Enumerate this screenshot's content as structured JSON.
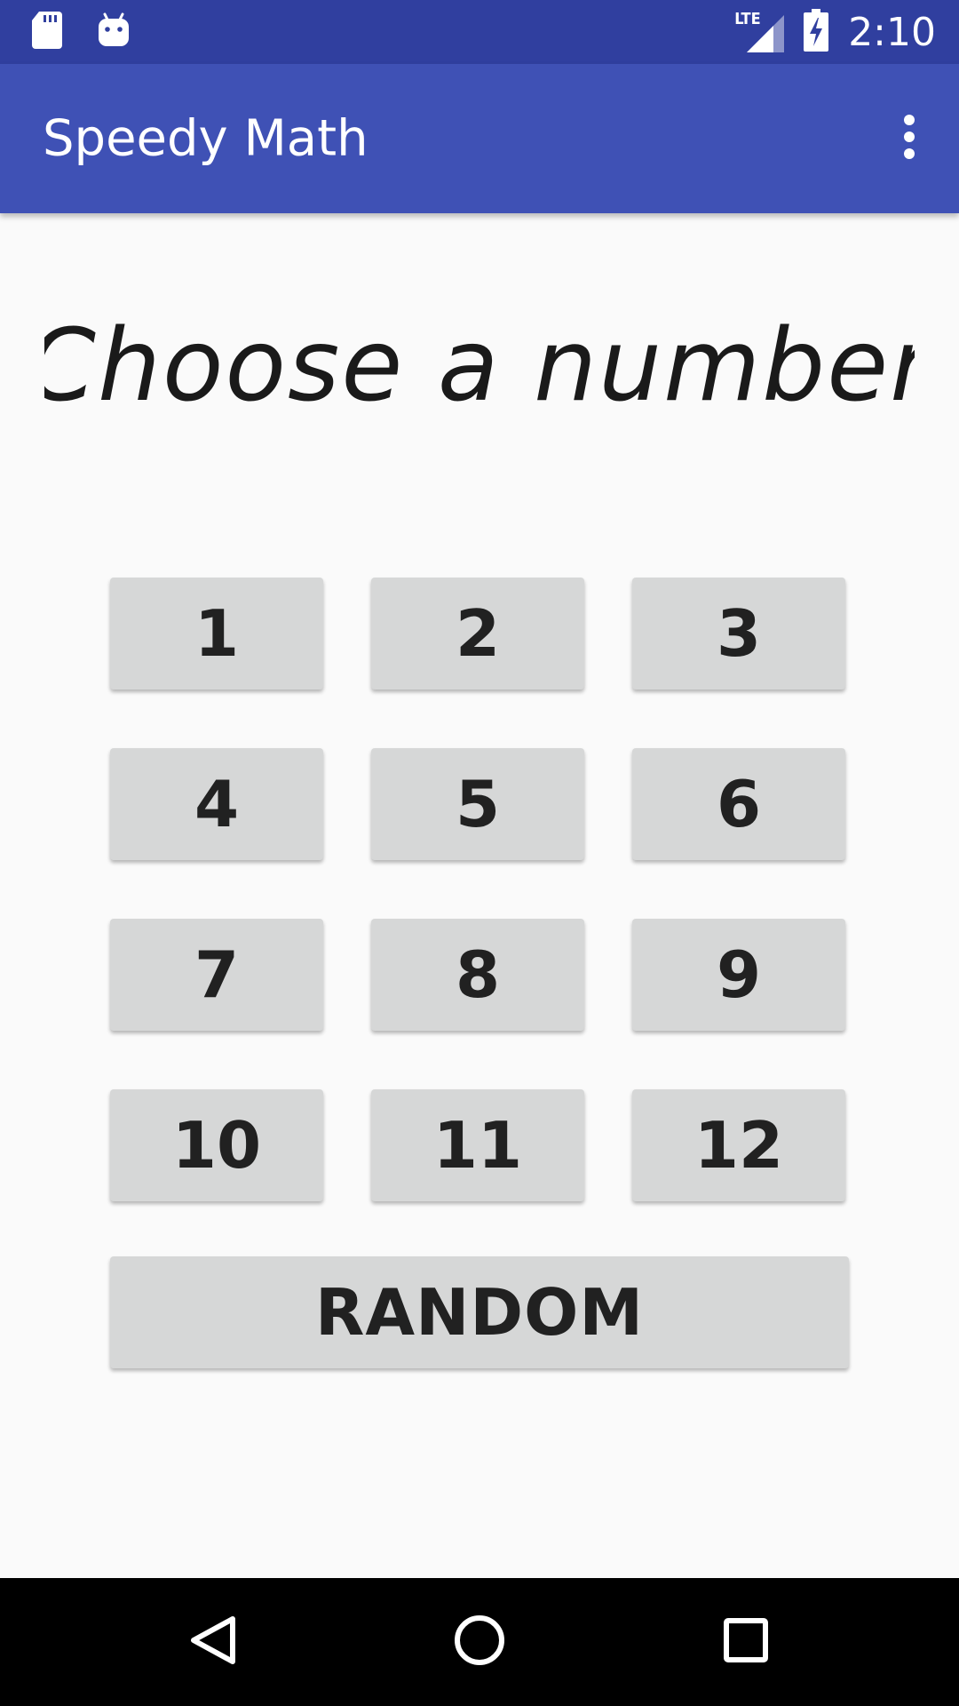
{
  "status_bar": {
    "time": "2:10",
    "network_label": "LTE",
    "icons": [
      "sd-card-icon",
      "android-notification-icon",
      "lte-signal-icon",
      "battery-charging-icon"
    ]
  },
  "app_bar": {
    "title": "Speedy Math",
    "menu_icon": "more-vert-icon"
  },
  "main": {
    "heading": "Choose a number",
    "numbers": [
      "1",
      "2",
      "3",
      "4",
      "5",
      "6",
      "7",
      "8",
      "9",
      "10",
      "11",
      "12"
    ],
    "random_label": "RANDOM"
  },
  "nav_bar": {
    "icons": [
      "back-icon",
      "home-icon",
      "recents-icon"
    ]
  },
  "colors": {
    "status_bar": "#303f9f",
    "app_bar": "#3f51b5",
    "background": "#fafafa",
    "button": "#d6d7d7",
    "button_text": "#212121",
    "nav_bar": "#000000"
  }
}
